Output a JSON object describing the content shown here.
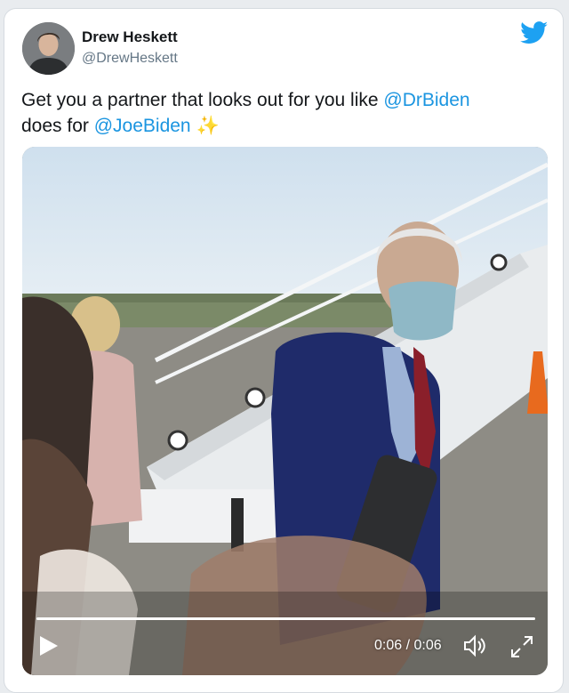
{
  "user": {
    "name": "Drew Heskett",
    "handle": "@DrewHeskett"
  },
  "tweet": {
    "line1_prefix": "Get you a partner that looks out for you like ",
    "mention1": "@DrBiden",
    "line2_prefix": "does for ",
    "mention2": "@JoeBiden",
    "emoji": "✨"
  },
  "video": {
    "time": "0:06 / 0:06",
    "progress": 1.0
  },
  "icons": {
    "brand": "twitter-bird-icon",
    "play": "play-icon",
    "volume": "volume-icon",
    "fullscreen": "fullscreen-icon"
  },
  "colors": {
    "link": "#1b95e0",
    "brand": "#1da1f2",
    "text": "#14171a",
    "muted": "#657786"
  }
}
